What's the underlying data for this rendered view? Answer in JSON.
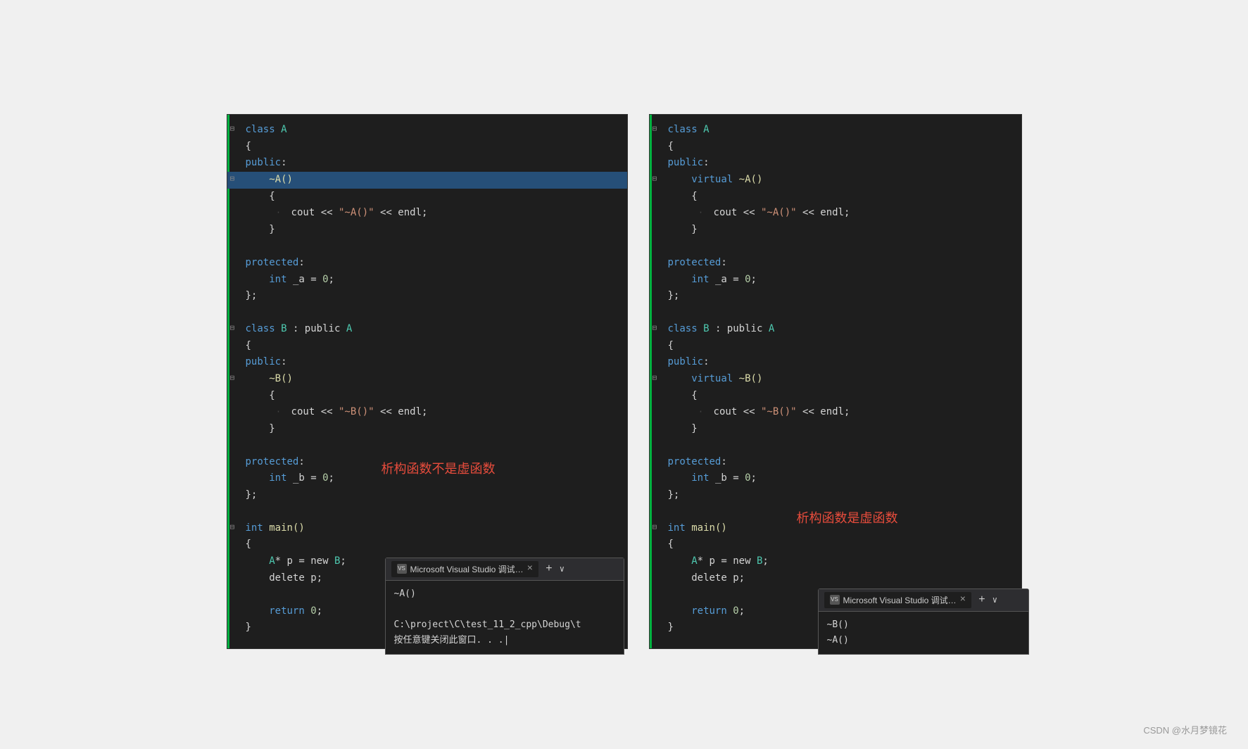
{
  "page": {
    "background": "#f0f0f0",
    "watermark": "CSDN @水月梦镜花"
  },
  "left_panel": {
    "annotation": "析构函数不是虚函数",
    "code": [
      {
        "indent": 0,
        "has_collapse": true,
        "collapse_char": "⊟",
        "content": [
          {
            "text": "class ",
            "class": "kw-blue"
          },
          {
            "text": "A",
            "class": "class-name"
          }
        ]
      },
      {
        "indent": 0,
        "content": [
          {
            "text": "{",
            "class": "kw-white"
          }
        ]
      },
      {
        "indent": 0,
        "content": [
          {
            "text": "public",
            "class": "access-blue"
          },
          {
            "text": ":",
            "class": "kw-white"
          }
        ]
      },
      {
        "indent": 1,
        "has_collapse": true,
        "collapse_char": "⊟",
        "highlight": true,
        "content": [
          {
            "text": "~A()",
            "class": "destructor"
          }
        ]
      },
      {
        "indent": 1,
        "content": [
          {
            "text": "{",
            "class": "kw-white"
          }
        ]
      },
      {
        "indent": 2,
        "dotted": true,
        "content": [
          {
            "text": "cout ",
            "class": "kw-white"
          },
          {
            "text": "<< ",
            "class": "kw-white"
          },
          {
            "text": "\"~A()\"",
            "class": "str-orange"
          },
          {
            "text": " << endl;",
            "class": "kw-white"
          }
        ]
      },
      {
        "indent": 1,
        "content": [
          {
            "text": "}",
            "class": "kw-white"
          }
        ]
      },
      {
        "indent": 0,
        "content": []
      },
      {
        "indent": 0,
        "content": [
          {
            "text": "protected",
            "class": "protected-kw"
          },
          {
            "text": ":",
            "class": "kw-white"
          }
        ]
      },
      {
        "indent": 1,
        "content": [
          {
            "text": "int",
            "class": "kw-int"
          },
          {
            "text": " _a = ",
            "class": "kw-white"
          },
          {
            "text": "0",
            "class": "num-green"
          },
          {
            "text": ";",
            "class": "kw-white"
          }
        ]
      },
      {
        "indent": 0,
        "content": [
          {
            "text": "};",
            "class": "kw-white"
          }
        ]
      },
      {
        "indent": 0,
        "content": []
      },
      {
        "indent": 0,
        "has_collapse": true,
        "collapse_char": "⊟",
        "content": [
          {
            "text": "class ",
            "class": "kw-blue"
          },
          {
            "text": "B",
            "class": "class-name"
          },
          {
            "text": " : public ",
            "class": "kw-white"
          },
          {
            "text": "A",
            "class": "class-name"
          }
        ]
      },
      {
        "indent": 0,
        "content": [
          {
            "text": "{",
            "class": "kw-white"
          }
        ]
      },
      {
        "indent": 0,
        "content": [
          {
            "text": "public",
            "class": "access-blue"
          },
          {
            "text": ":",
            "class": "kw-white"
          }
        ]
      },
      {
        "indent": 1,
        "has_collapse": true,
        "collapse_char": "⊟",
        "content": [
          {
            "text": "~B()",
            "class": "destructor"
          }
        ]
      },
      {
        "indent": 1,
        "content": [
          {
            "text": "{",
            "class": "kw-white"
          }
        ]
      },
      {
        "indent": 2,
        "dotted": true,
        "content": [
          {
            "text": "cout ",
            "class": "kw-white"
          },
          {
            "text": "<< ",
            "class": "kw-white"
          },
          {
            "text": "\"~B()\"",
            "class": "str-orange"
          },
          {
            "text": " << endl;",
            "class": "kw-white"
          }
        ]
      },
      {
        "indent": 1,
        "content": [
          {
            "text": "}",
            "class": "kw-white"
          }
        ]
      },
      {
        "indent": 0,
        "content": []
      },
      {
        "indent": 0,
        "content": [
          {
            "text": "protected",
            "class": "protected-kw"
          },
          {
            "text": ":",
            "class": "kw-white"
          }
        ]
      },
      {
        "indent": 1,
        "content": [
          {
            "text": "int",
            "class": "kw-int"
          },
          {
            "text": " _b = ",
            "class": "kw-white"
          },
          {
            "text": "0",
            "class": "num-green"
          },
          {
            "text": ";",
            "class": "kw-white"
          }
        ]
      },
      {
        "indent": 0,
        "content": [
          {
            "text": "};",
            "class": "kw-white"
          }
        ]
      },
      {
        "indent": 0,
        "content": []
      },
      {
        "indent": 0,
        "has_collapse": true,
        "collapse_char": "⊟",
        "content": [
          {
            "text": "int",
            "class": "kw-int"
          },
          {
            "text": " ",
            "class": "kw-white"
          },
          {
            "text": "main()",
            "class": "func-yellow"
          }
        ]
      },
      {
        "indent": 0,
        "content": [
          {
            "text": "{",
            "class": "kw-white"
          }
        ]
      },
      {
        "indent": 1,
        "content": [
          {
            "text": "A",
            "class": "class-name"
          },
          {
            "text": "* p = new ",
            "class": "kw-white"
          },
          {
            "text": "B",
            "class": "class-name"
          },
          {
            "text": ";",
            "class": "kw-white"
          }
        ]
      },
      {
        "indent": 1,
        "content": [
          {
            "text": "delete p;",
            "class": "kw-white"
          }
        ]
      },
      {
        "indent": 0,
        "content": []
      },
      {
        "indent": 1,
        "content": [
          {
            "text": "return ",
            "class": "kw-blue"
          },
          {
            "text": "0",
            "class": "num-green"
          },
          {
            "text": ";",
            "class": "kw-white"
          }
        ]
      },
      {
        "indent": 0,
        "content": [
          {
            "text": "}",
            "class": "kw-white"
          }
        ]
      }
    ],
    "debug": {
      "tab_label": "Microsoft Visual Studio 调试…",
      "output": [
        "~A()",
        "",
        "C:\\project\\C\\test_11_2_cpp\\Debug\\t",
        "按任意键关闭此窗口. . .|"
      ]
    }
  },
  "right_panel": {
    "annotation": "析构函数是虚函数",
    "code": [
      {
        "indent": 0,
        "has_collapse": true,
        "collapse_char": "⊟",
        "content": [
          {
            "text": "class ",
            "class": "kw-blue"
          },
          {
            "text": "A",
            "class": "class-name"
          }
        ]
      },
      {
        "indent": 0,
        "content": [
          {
            "text": "{",
            "class": "kw-white"
          }
        ]
      },
      {
        "indent": 0,
        "content": [
          {
            "text": "public",
            "class": "access-blue"
          },
          {
            "text": ":",
            "class": "kw-white"
          }
        ]
      },
      {
        "indent": 1,
        "has_collapse": true,
        "collapse_char": "⊟",
        "content": [
          {
            "text": "virtual ",
            "class": "virtual-kw"
          },
          {
            "text": "~A()",
            "class": "destructor"
          }
        ]
      },
      {
        "indent": 1,
        "content": [
          {
            "text": "{",
            "class": "kw-white"
          }
        ]
      },
      {
        "indent": 2,
        "dotted": true,
        "content": [
          {
            "text": "cout ",
            "class": "kw-white"
          },
          {
            "text": "<< ",
            "class": "kw-white"
          },
          {
            "text": "\"~A()\"",
            "class": "str-orange"
          },
          {
            "text": " << endl;",
            "class": "kw-white"
          }
        ]
      },
      {
        "indent": 1,
        "content": [
          {
            "text": "}",
            "class": "kw-white"
          }
        ]
      },
      {
        "indent": 0,
        "content": []
      },
      {
        "indent": 0,
        "content": [
          {
            "text": "protected",
            "class": "protected-kw"
          },
          {
            "text": ":",
            "class": "kw-white"
          }
        ]
      },
      {
        "indent": 1,
        "content": [
          {
            "text": "int",
            "class": "kw-int"
          },
          {
            "text": " _a = ",
            "class": "kw-white"
          },
          {
            "text": "0",
            "class": "num-green"
          },
          {
            "text": ";",
            "class": "kw-white"
          }
        ]
      },
      {
        "indent": 0,
        "content": [
          {
            "text": "};",
            "class": "kw-white"
          }
        ]
      },
      {
        "indent": 0,
        "content": []
      },
      {
        "indent": 0,
        "has_collapse": true,
        "collapse_char": "⊟",
        "content": [
          {
            "text": "class ",
            "class": "kw-blue"
          },
          {
            "text": "B",
            "class": "class-name"
          },
          {
            "text": " : public ",
            "class": "kw-white"
          },
          {
            "text": "A",
            "class": "class-name"
          }
        ]
      },
      {
        "indent": 0,
        "content": [
          {
            "text": "{",
            "class": "kw-white"
          }
        ]
      },
      {
        "indent": 0,
        "content": [
          {
            "text": "public",
            "class": "access-blue"
          },
          {
            "text": ":",
            "class": "kw-white"
          }
        ]
      },
      {
        "indent": 1,
        "has_collapse": true,
        "collapse_char": "⊟",
        "content": [
          {
            "text": "virtual ",
            "class": "virtual-kw"
          },
          {
            "text": "~B()",
            "class": "destructor"
          }
        ]
      },
      {
        "indent": 1,
        "content": [
          {
            "text": "{",
            "class": "kw-white"
          }
        ]
      },
      {
        "indent": 2,
        "dotted": true,
        "content": [
          {
            "text": "cout ",
            "class": "kw-white"
          },
          {
            "text": "<< ",
            "class": "kw-white"
          },
          {
            "text": "\"~B()\"",
            "class": "str-orange"
          },
          {
            "text": " << endl;",
            "class": "kw-white"
          }
        ]
      },
      {
        "indent": 1,
        "content": [
          {
            "text": "}",
            "class": "kw-white"
          }
        ]
      },
      {
        "indent": 0,
        "content": []
      },
      {
        "indent": 0,
        "content": [
          {
            "text": "protected",
            "class": "protected-kw"
          },
          {
            "text": ":",
            "class": "kw-white"
          }
        ]
      },
      {
        "indent": 1,
        "content": [
          {
            "text": "int",
            "class": "kw-int"
          },
          {
            "text": " _b = ",
            "class": "kw-white"
          },
          {
            "text": "0",
            "class": "num-green"
          },
          {
            "text": ";",
            "class": "kw-white"
          }
        ]
      },
      {
        "indent": 0,
        "content": [
          {
            "text": "};",
            "class": "kw-white"
          }
        ]
      },
      {
        "indent": 0,
        "content": []
      },
      {
        "indent": 0,
        "has_collapse": true,
        "collapse_char": "⊟",
        "content": [
          {
            "text": "int",
            "class": "kw-int"
          },
          {
            "text": " ",
            "class": "kw-white"
          },
          {
            "text": "main()",
            "class": "func-yellow"
          }
        ]
      },
      {
        "indent": 0,
        "content": [
          {
            "text": "{",
            "class": "kw-white"
          }
        ]
      },
      {
        "indent": 1,
        "content": [
          {
            "text": "A",
            "class": "class-name"
          },
          {
            "text": "* p = new ",
            "class": "kw-white"
          },
          {
            "text": "B",
            "class": "class-name"
          },
          {
            "text": ";",
            "class": "kw-white"
          }
        ]
      },
      {
        "indent": 1,
        "content": [
          {
            "text": "delete p;",
            "class": "kw-white"
          }
        ]
      },
      {
        "indent": 0,
        "content": []
      },
      {
        "indent": 1,
        "content": [
          {
            "text": "return ",
            "class": "kw-blue"
          },
          {
            "text": "0",
            "class": "num-green"
          },
          {
            "text": ";",
            "class": "kw-white"
          }
        ]
      },
      {
        "indent": 0,
        "content": [
          {
            "text": "}",
            "class": "kw-white"
          }
        ]
      }
    ],
    "debug": {
      "tab_label": "Microsoft Visual Studio 调试…",
      "output": [
        "~B()",
        "~A()"
      ]
    }
  }
}
